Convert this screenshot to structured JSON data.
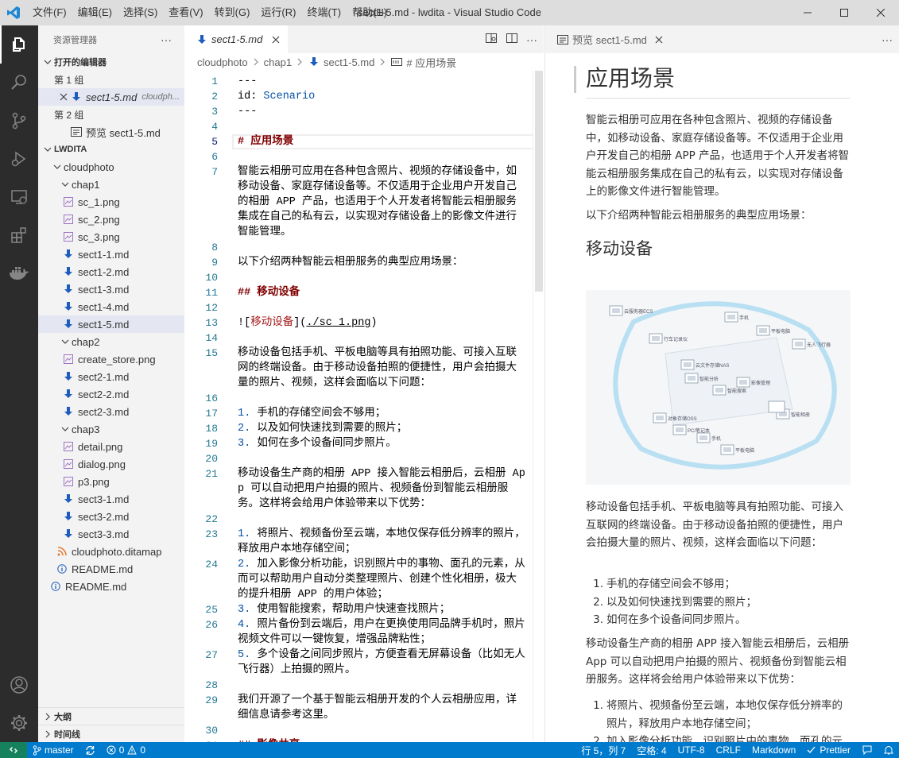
{
  "titlebar": {
    "title": "sect1-5.md - lwdita - Visual Studio Code",
    "menu": [
      "文件(F)",
      "编辑(E)",
      "选择(S)",
      "查看(V)",
      "转到(G)",
      "运行(R)",
      "终端(T)",
      "帮助(H)"
    ]
  },
  "activity": {
    "icons": [
      "explorer-icon",
      "search-icon",
      "source-control-icon",
      "run-debug-icon",
      "remote-explorer-icon",
      "extensions-icon",
      "docker-icon"
    ],
    "bottom_icons": [
      "account-icon",
      "manage-gear-icon"
    ]
  },
  "sidebar": {
    "header": "资源管理器",
    "more": "···",
    "open_editors_title": "打开的编辑器",
    "group1": "第 1 组",
    "group1_file": "sect1-5.md",
    "group1_path": "cloudph...",
    "group2": "第 2 组",
    "group2_file": "预览 sect1-5.md",
    "workspace": "LWDITA",
    "tree": {
      "cloudphoto": "cloudphoto",
      "chap1": "chap1",
      "chap1_files": [
        "sc_1.png",
        "sc_2.png",
        "sc_3.png",
        "sect1-1.md",
        "sect1-2.md",
        "sect1-3.md",
        "sect1-4.md",
        "sect1-5.md"
      ],
      "chap2": "chap2",
      "chap2_files": [
        "create_store.png",
        "sect2-1.md",
        "sect2-2.md",
        "sect2-3.md"
      ],
      "chap3": "chap3",
      "chap3_files": [
        "detail.png",
        "dialog.png",
        "p3.png",
        "sect3-1.md",
        "sect3-2.md",
        "sect3-3.md"
      ],
      "ditamap": "cloudphoto.ditamap",
      "readme_inner": "README.md",
      "readme_root": "README.md"
    },
    "outline": "大纲",
    "timeline": "时间线"
  },
  "editor": {
    "tab_label": "sect1-5.md",
    "breadcrumb": [
      "cloudphoto",
      "chap1",
      "sect1-5.md",
      "# 应用场景"
    ],
    "lines": [
      {
        "n": "1",
        "t": "---"
      },
      {
        "n": "2",
        "k": "id",
        "v": "Scenario"
      },
      {
        "n": "3",
        "t": "---"
      },
      {
        "n": "4",
        "t": ""
      },
      {
        "n": "5",
        "h": "# 应用场景"
      },
      {
        "n": "6",
        "t": ""
      },
      {
        "n": "7",
        "t": "智能云相册可应用在各种包含照片、视频的存储设备中，如移动设备、家庭存储设备等。不仅适用于企业用户开发自己的相册 APP 产品，也适用于个人开发者将智能云相册服务集成在自己的私有云，以实现对存储设备上的影像文件进行智能管理。"
      },
      {
        "n": "8",
        "t": ""
      },
      {
        "n": "9",
        "t": "以下介绍两种智能云相册服务的典型应用场景："
      },
      {
        "n": "10",
        "t": ""
      },
      {
        "n": "11",
        "h": "## 移动设备"
      },
      {
        "n": "12",
        "t": ""
      },
      {
        "n": "13",
        "img_alt": "移动设备",
        "img_url": "./sc_1.png"
      },
      {
        "n": "14",
        "t": ""
      },
      {
        "n": "15",
        "t": "移动设备包括手机、平板电脑等具有拍照功能、可接入互联网的终端设备。由于移动设备拍照的便捷性，用户会拍摄大量的照片、视频，这样会面临以下问题："
      },
      {
        "n": "16",
        "t": ""
      },
      {
        "n": "17",
        "num": "1.",
        "t": "手机的存储空间会不够用；"
      },
      {
        "n": "18",
        "num": "2.",
        "t": "以及如何快速找到需要的照片；"
      },
      {
        "n": "19",
        "num": "3.",
        "t": "如何在多个设备间同步照片。"
      },
      {
        "n": "20",
        "t": ""
      },
      {
        "n": "21",
        "t": "移动设备生产商的相册 APP 接入智能云相册后，云相册 App 可以自动把用户拍摄的照片、视频备份到智能云相册服务。这样将会给用户体验带来以下优势："
      },
      {
        "n": "22",
        "t": ""
      },
      {
        "n": "23",
        "num": "1.",
        "t": "将照片、视频备份至云端，本地仅保存低分辨率的照片，释放用户本地存储空间；"
      },
      {
        "n": "24",
        "num": "2.",
        "t": "加入影像分析功能，识别照片中的事物、面孔的元素，从而可以帮助用户自动分类整理照片、创建个性化相册，极大的提升相册 APP 的用户体验；"
      },
      {
        "n": "25",
        "num": "3.",
        "t": "使用智能搜索，帮助用户快速查找照片；"
      },
      {
        "n": "26",
        "num": "4.",
        "t": "照片备份到云端后，用户在更换使用同品牌手机时，照片视频文件可以一键恢复，增强品牌粘性；"
      },
      {
        "n": "27",
        "num": "5.",
        "t": "多个设备之间同步照片，方便查看无屏幕设备（比如无人飞行器）上拍摄的照片。"
      },
      {
        "n": "28",
        "t": ""
      },
      {
        "n": "29",
        "t": "我们开源了一个基于智能云相册开发的个人云相册应用，详细信息请参考这里。"
      },
      {
        "n": "30",
        "t": ""
      },
      {
        "n": "31",
        "h": "## 影像共享"
      }
    ]
  },
  "preview": {
    "tab_label": "预览 sect1-5.md",
    "h1": "应用场景",
    "p1": "智能云相册可应用在各种包含照片、视频的存储设备中，如移动设备、家庭存储设备等。不仅适用于企业用户开发自己的相册 APP 产品，也适用于个人开发者将智能云相册服务集成在自己的私有云，以实现对存储设备上的影像文件进行智能管理。",
    "p2": "以下介绍两种智能云相册服务的典型应用场景：",
    "h2": "移动设备",
    "diagram_labels": [
      "云服务器ECS",
      "手机",
      "平板电脑",
      "无人飞行器",
      "行车记录仪",
      "云文件存储NAS",
      "智能分析",
      "智能搜索",
      "影像管理",
      "智能相册",
      "对象存储OSS",
      "PC/笔记本",
      "手机",
      "平板电脑",
      "智能电视"
    ],
    "p3": "移动设备包括手机、平板电脑等具有拍照功能、可接入互联网的终端设备。由于移动设备拍照的便捷性，用户会拍摄大量的照片、视频，这样会面临以下问题：",
    "list1": [
      "手机的存储空间会不够用；",
      "以及如何快速找到需要的照片；",
      "如何在多个设备间同步照片。"
    ],
    "p4": "移动设备生产商的相册 APP 接入智能云相册后，云相册 App 可以自动把用户拍摄的照片、视频备份到智能云相册服务。这样将会给用户体验带来以下优势：",
    "list2": [
      "将照片、视频备份至云端，本地仅保存低分辨率的照片，释放用户本地存储空间；",
      "加入影像分析功能，识别照片中的事物、面孔的元素，从而可以帮助用户自动分类整理照片、创"
    ]
  },
  "status": {
    "branch": "master",
    "errors": "0",
    "warnings": "0",
    "position": "行 5，列 7",
    "spaces": "空格: 4",
    "encoding": "UTF-8",
    "eol": "CRLF",
    "language": "Markdown",
    "prettier": "Prettier"
  },
  "colors": {
    "titlebar_bg": "#dddddd",
    "activity_bg": "#2c2c2c",
    "sidebar_bg": "#f3f3f3",
    "status_bg": "#007acc",
    "remote_bg": "#16825d",
    "heading": "#800000",
    "link": "#a31515",
    "line_number": "#237893",
    "md_icon": "#1e5dbd",
    "png_icon": "#a074c4"
  }
}
